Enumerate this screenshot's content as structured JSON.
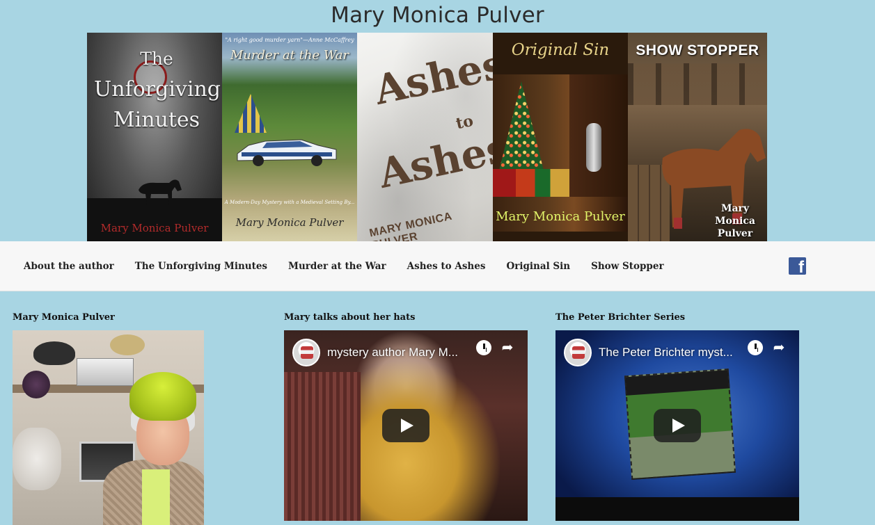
{
  "site": {
    "title": "Mary Monica Pulver"
  },
  "banner": {
    "covers": [
      {
        "name": "The Unforgiving Minutes",
        "title_line1": "The",
        "title_line2": "Unforgiving",
        "title_line3": "Minutes",
        "author": "Mary Monica Pulver"
      },
      {
        "name": "Murder at the War",
        "blurb": "\"A right good murder yarn\"—Anne McCaffrey",
        "title": "Murder at the War",
        "subtitle": "A Modern-Day Mystery with a Medieval Setting By...",
        "author": "Mary Monica Pulver"
      },
      {
        "name": "Ashes to Ashes",
        "title_word1": "Ashes",
        "title_word2": "to",
        "title_word3": "Ashes",
        "author": "MARY MONICA PULVER"
      },
      {
        "name": "Original Sin",
        "title": "Original Sin",
        "author": "Mary Monica Pulver"
      },
      {
        "name": "Show Stopper",
        "title": "SHOW STOPPER",
        "author_line1": "Mary",
        "author_line2": "Monica",
        "author_line3": "Pulver"
      }
    ]
  },
  "nav": {
    "items": [
      {
        "label": "About the author"
      },
      {
        "label": "The Unforgiving Minutes"
      },
      {
        "label": "Murder at the War"
      },
      {
        "label": "Ashes to Ashes"
      },
      {
        "label": "Original Sin"
      },
      {
        "label": "Show Stopper"
      }
    ],
    "facebook_icon": "facebook-icon",
    "facebook_glyph": "f"
  },
  "content": {
    "col1": {
      "title": "Mary Monica Pulver"
    },
    "col2": {
      "title": "Mary talks about her hats",
      "video_title": "mystery author Mary M..."
    },
    "col3": {
      "title": "The Peter Brichter Series",
      "video_title": "The Peter Brichter myst..."
    }
  },
  "icons": {
    "share": "share-icon",
    "share_glyph": "➦",
    "watch_later": "clock-icon",
    "play": "play-icon"
  },
  "colors": {
    "page_background": "#a8d5e3",
    "nav_background": "#f7f7f7",
    "facebook_blue": "#3b5998"
  }
}
